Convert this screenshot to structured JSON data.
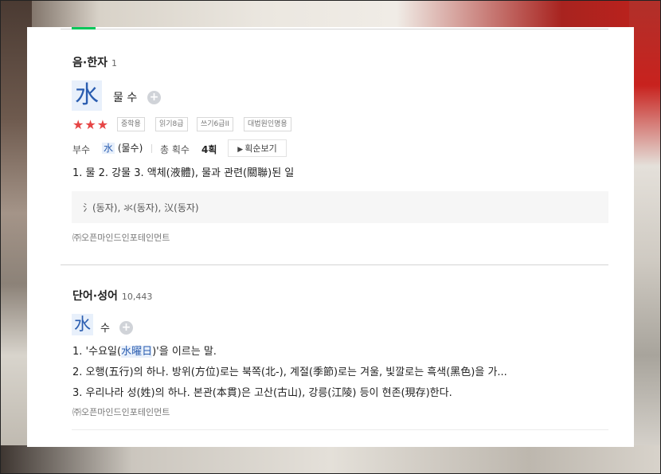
{
  "hanja_section": {
    "title": "음·한자",
    "count": "1",
    "character": "水",
    "reading": "물 수",
    "stars": "★★★",
    "tags": [
      "중학용",
      "읽기8급",
      "쓰기6급II",
      "대법원인명용"
    ],
    "radical_label": "부수",
    "radical_hanja": "水",
    "radical_text": " (물수)",
    "strokes_label": "총 획수",
    "strokes_value": "4획",
    "stroke_order_button": "획순보기",
    "meaning": "1. 물  2. 강물  3. 액체(液體), 물과 관련(關聯)된 일",
    "variants": "氵(동자), 氺(동자), 㲼(동자)",
    "source": "㈜오픈마인드인포테인먼트"
  },
  "word_section": {
    "title": "단어·성어",
    "count": "10,443",
    "hanja": "水",
    "reading": "수",
    "definitions": [
      {
        "before": "1. '수요일(",
        "highlight": "水曜日",
        "after": ")'을 이르는 말."
      },
      {
        "before": "2. 오행(五行)의 하나. 방위(方位)로는 북쪽(北-), 계절(季節)로는 겨울, 빛깔로는 흑색(黑色)을 가...",
        "highlight": "",
        "after": ""
      },
      {
        "before": "3. 우리나라 성(姓)의 하나. 본관(本貫)은 고산(古山), 강릉(江陵) 등이 현존(現存)한다.",
        "highlight": "",
        "after": ""
      }
    ],
    "source": "㈜오픈마인드인포테인먼트"
  },
  "icons": {
    "plus": "+",
    "triangle": "▶"
  },
  "colors": {
    "accent": "#2a5db0",
    "highlight_bg": "#e8f0fb",
    "star": "#e64545",
    "tab": "#03c75a"
  }
}
